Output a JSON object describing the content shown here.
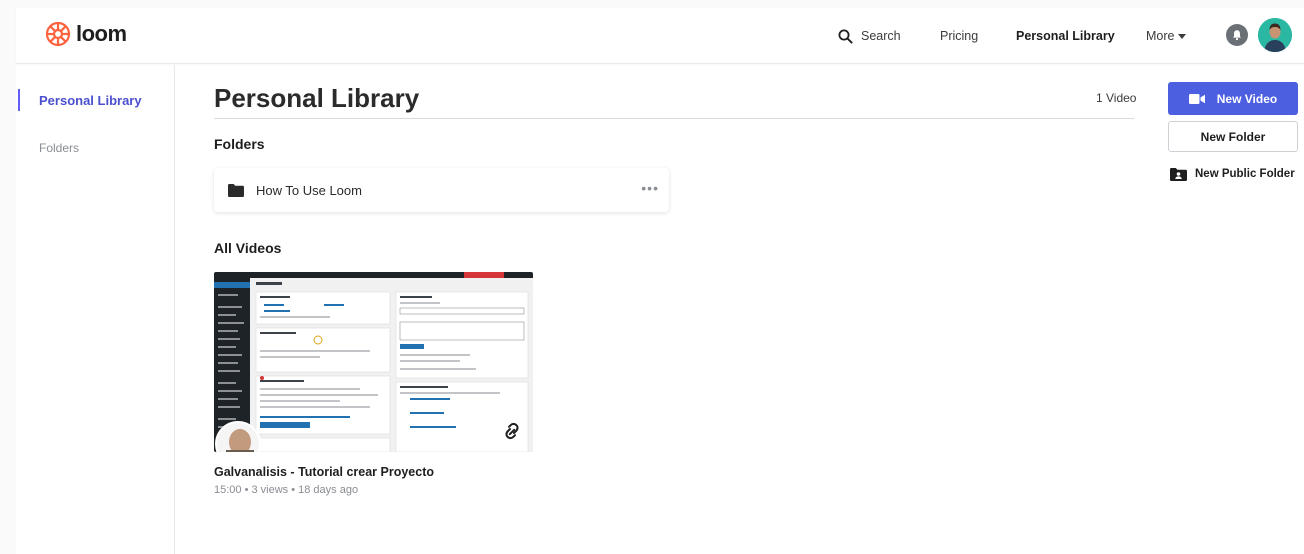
{
  "header": {
    "logo_text": "loom",
    "nav": {
      "search": "Search",
      "pricing": "Pricing",
      "personal_library": "Personal Library",
      "more": "More"
    }
  },
  "sidebar": {
    "items": [
      {
        "label": "Personal Library",
        "active": true
      },
      {
        "label": "Folders",
        "active": false
      }
    ]
  },
  "main": {
    "title": "Personal Library",
    "video_count": "1 Video",
    "folders_heading": "Folders",
    "folders": [
      {
        "name": "How To Use Loom",
        "menu": "•••"
      }
    ],
    "videos_heading": "All Videos",
    "videos": [
      {
        "title": "Galvanalisis - Tutorial crear Proyecto",
        "meta": "15:00 • 3 views • 18 days ago"
      }
    ]
  },
  "actions": {
    "new_video": "New Video",
    "new_folder": "New Folder",
    "new_public_folder": "New Public Folder"
  },
  "colors": {
    "brand_orange": "#ff623e",
    "primary_blue": "#4b5fe0",
    "active_sidebar": "#4b50cf"
  }
}
